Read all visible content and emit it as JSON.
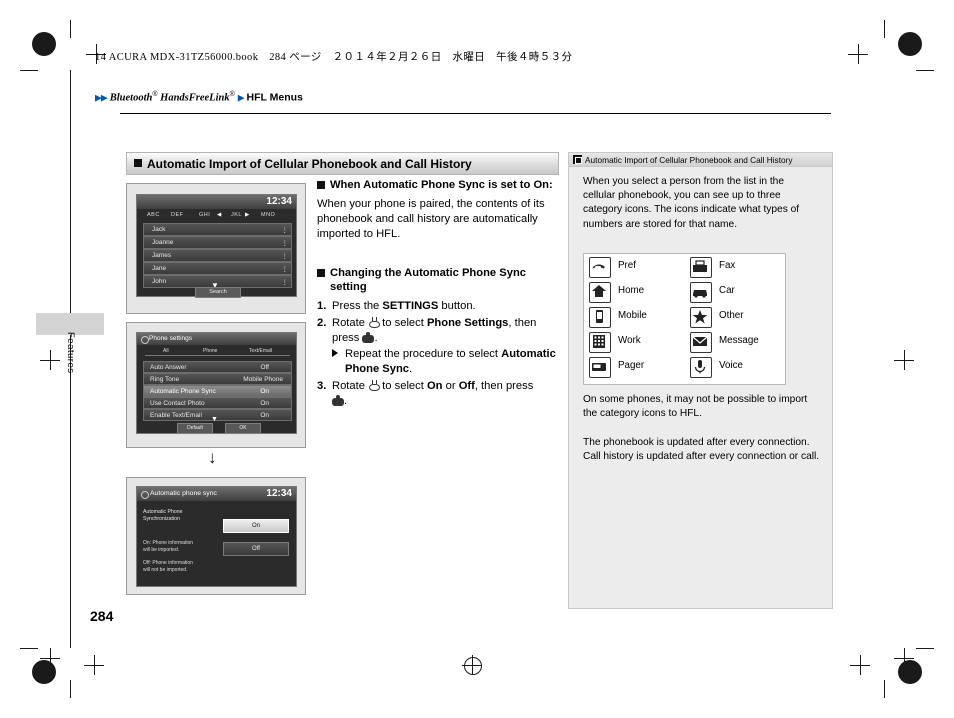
{
  "header": {
    "book_line": "14 ACURA MDX-31TZ56000.book　284 ページ　２０１４年２月２６日　水曜日　午後４時５３分",
    "breadcrumb_arrows": "▶▶",
    "breadcrumb_part1": "Bluetooth",
    "breadcrumb_sup1": "®",
    "breadcrumb_part2": " HandsFreeLink",
    "breadcrumb_sup2": "®",
    "breadcrumb_arrow2": "▶",
    "breadcrumb_part3": "HFL Menus"
  },
  "side_tab_label": "Features",
  "page_number": "284",
  "section": {
    "title": "Automatic Import of Cellular Phonebook and Call History"
  },
  "middle": {
    "sub1_title": "When Automatic Phone Sync is set to On:",
    "sub1_body": "When your phone is paired, the contents of its phonebook and call history are automatically imported to HFL.",
    "sub2_title": "Changing the Automatic Phone Sync setting",
    "step1_num": "1.",
    "step1_a": "Press the ",
    "step1_b": "SETTINGS",
    "step1_c": " button.",
    "step2_num": "2.",
    "step2_a": "Rotate ",
    "step2_b": " to select ",
    "step2_c": "Phone Settings",
    "step2_d": ", then press ",
    "step2_e": ".",
    "step2_sub_a": "Repeat the procedure to select ",
    "step2_sub_b": "Automatic Phone Sync",
    "step2_sub_c": ".",
    "step3_num": "3.",
    "step3_a": "Rotate ",
    "step3_b": " to select ",
    "step3_c": "On",
    "step3_d": " or ",
    "step3_e": "Off",
    "step3_f": ", then press ",
    "step3_g": "."
  },
  "side_panel": {
    "head_title": "Automatic Import of Cellular Phonebook and Call History",
    "body": "When you select a person from the list in the cellular phonebook, you can see up to three category icons. The icons indicate what types of numbers are stored for that name.",
    "note1": "On some phones, it may not be possible to import the category icons to HFL.",
    "note2": "The phonebook is updated after every connection. Call history is updated after every connection or call.",
    "icons": [
      {
        "name": "Pref",
        "icon": "phone-pref-icon"
      },
      {
        "name": "Fax",
        "icon": "fax-icon"
      },
      {
        "name": "Home",
        "icon": "home-icon"
      },
      {
        "name": "Car",
        "icon": "car-icon"
      },
      {
        "name": "Mobile",
        "icon": "mobile-icon"
      },
      {
        "name": "Other",
        "icon": "star-other-icon"
      },
      {
        "name": "Work",
        "icon": "work-building-icon"
      },
      {
        "name": "Message",
        "icon": "message-envelope-icon"
      },
      {
        "name": "Pager",
        "icon": "pager-icon"
      },
      {
        "name": "Voice",
        "icon": "voice-icon"
      }
    ]
  },
  "screens": {
    "phonebook": {
      "clock": "12:34",
      "tabs": [
        "ABC",
        "DEF",
        "GHI",
        "JKL",
        "MNO"
      ],
      "names": [
        "Jack",
        "Joanne",
        "James",
        "Jane",
        "John"
      ],
      "button": "Search"
    },
    "phone_settings": {
      "title": "Phone settings",
      "tabs": [
        "All",
        "Phone",
        "Text/Email"
      ],
      "rows": [
        {
          "label": "Auto Answer",
          "value": "Off"
        },
        {
          "label": "Ring Tone",
          "value": "Mobile Phone"
        },
        {
          "label": "Automatic Phone Sync",
          "value": "On"
        },
        {
          "label": "Use Contact Photo",
          "value": "On"
        },
        {
          "label": "Enable Text/Email",
          "value": "On"
        }
      ],
      "buttons": [
        "Default",
        "OK"
      ]
    },
    "auto_sync": {
      "title": "Automatic phone sync",
      "clock": "12:34",
      "heading": "Automatic Phone Synchronization",
      "desc_on": "On: Phone information will be imported.",
      "desc_off": "Off: Phone information will not be imported.",
      "options": [
        "On",
        "Off"
      ]
    }
  },
  "arrow_glyph": "↓"
}
